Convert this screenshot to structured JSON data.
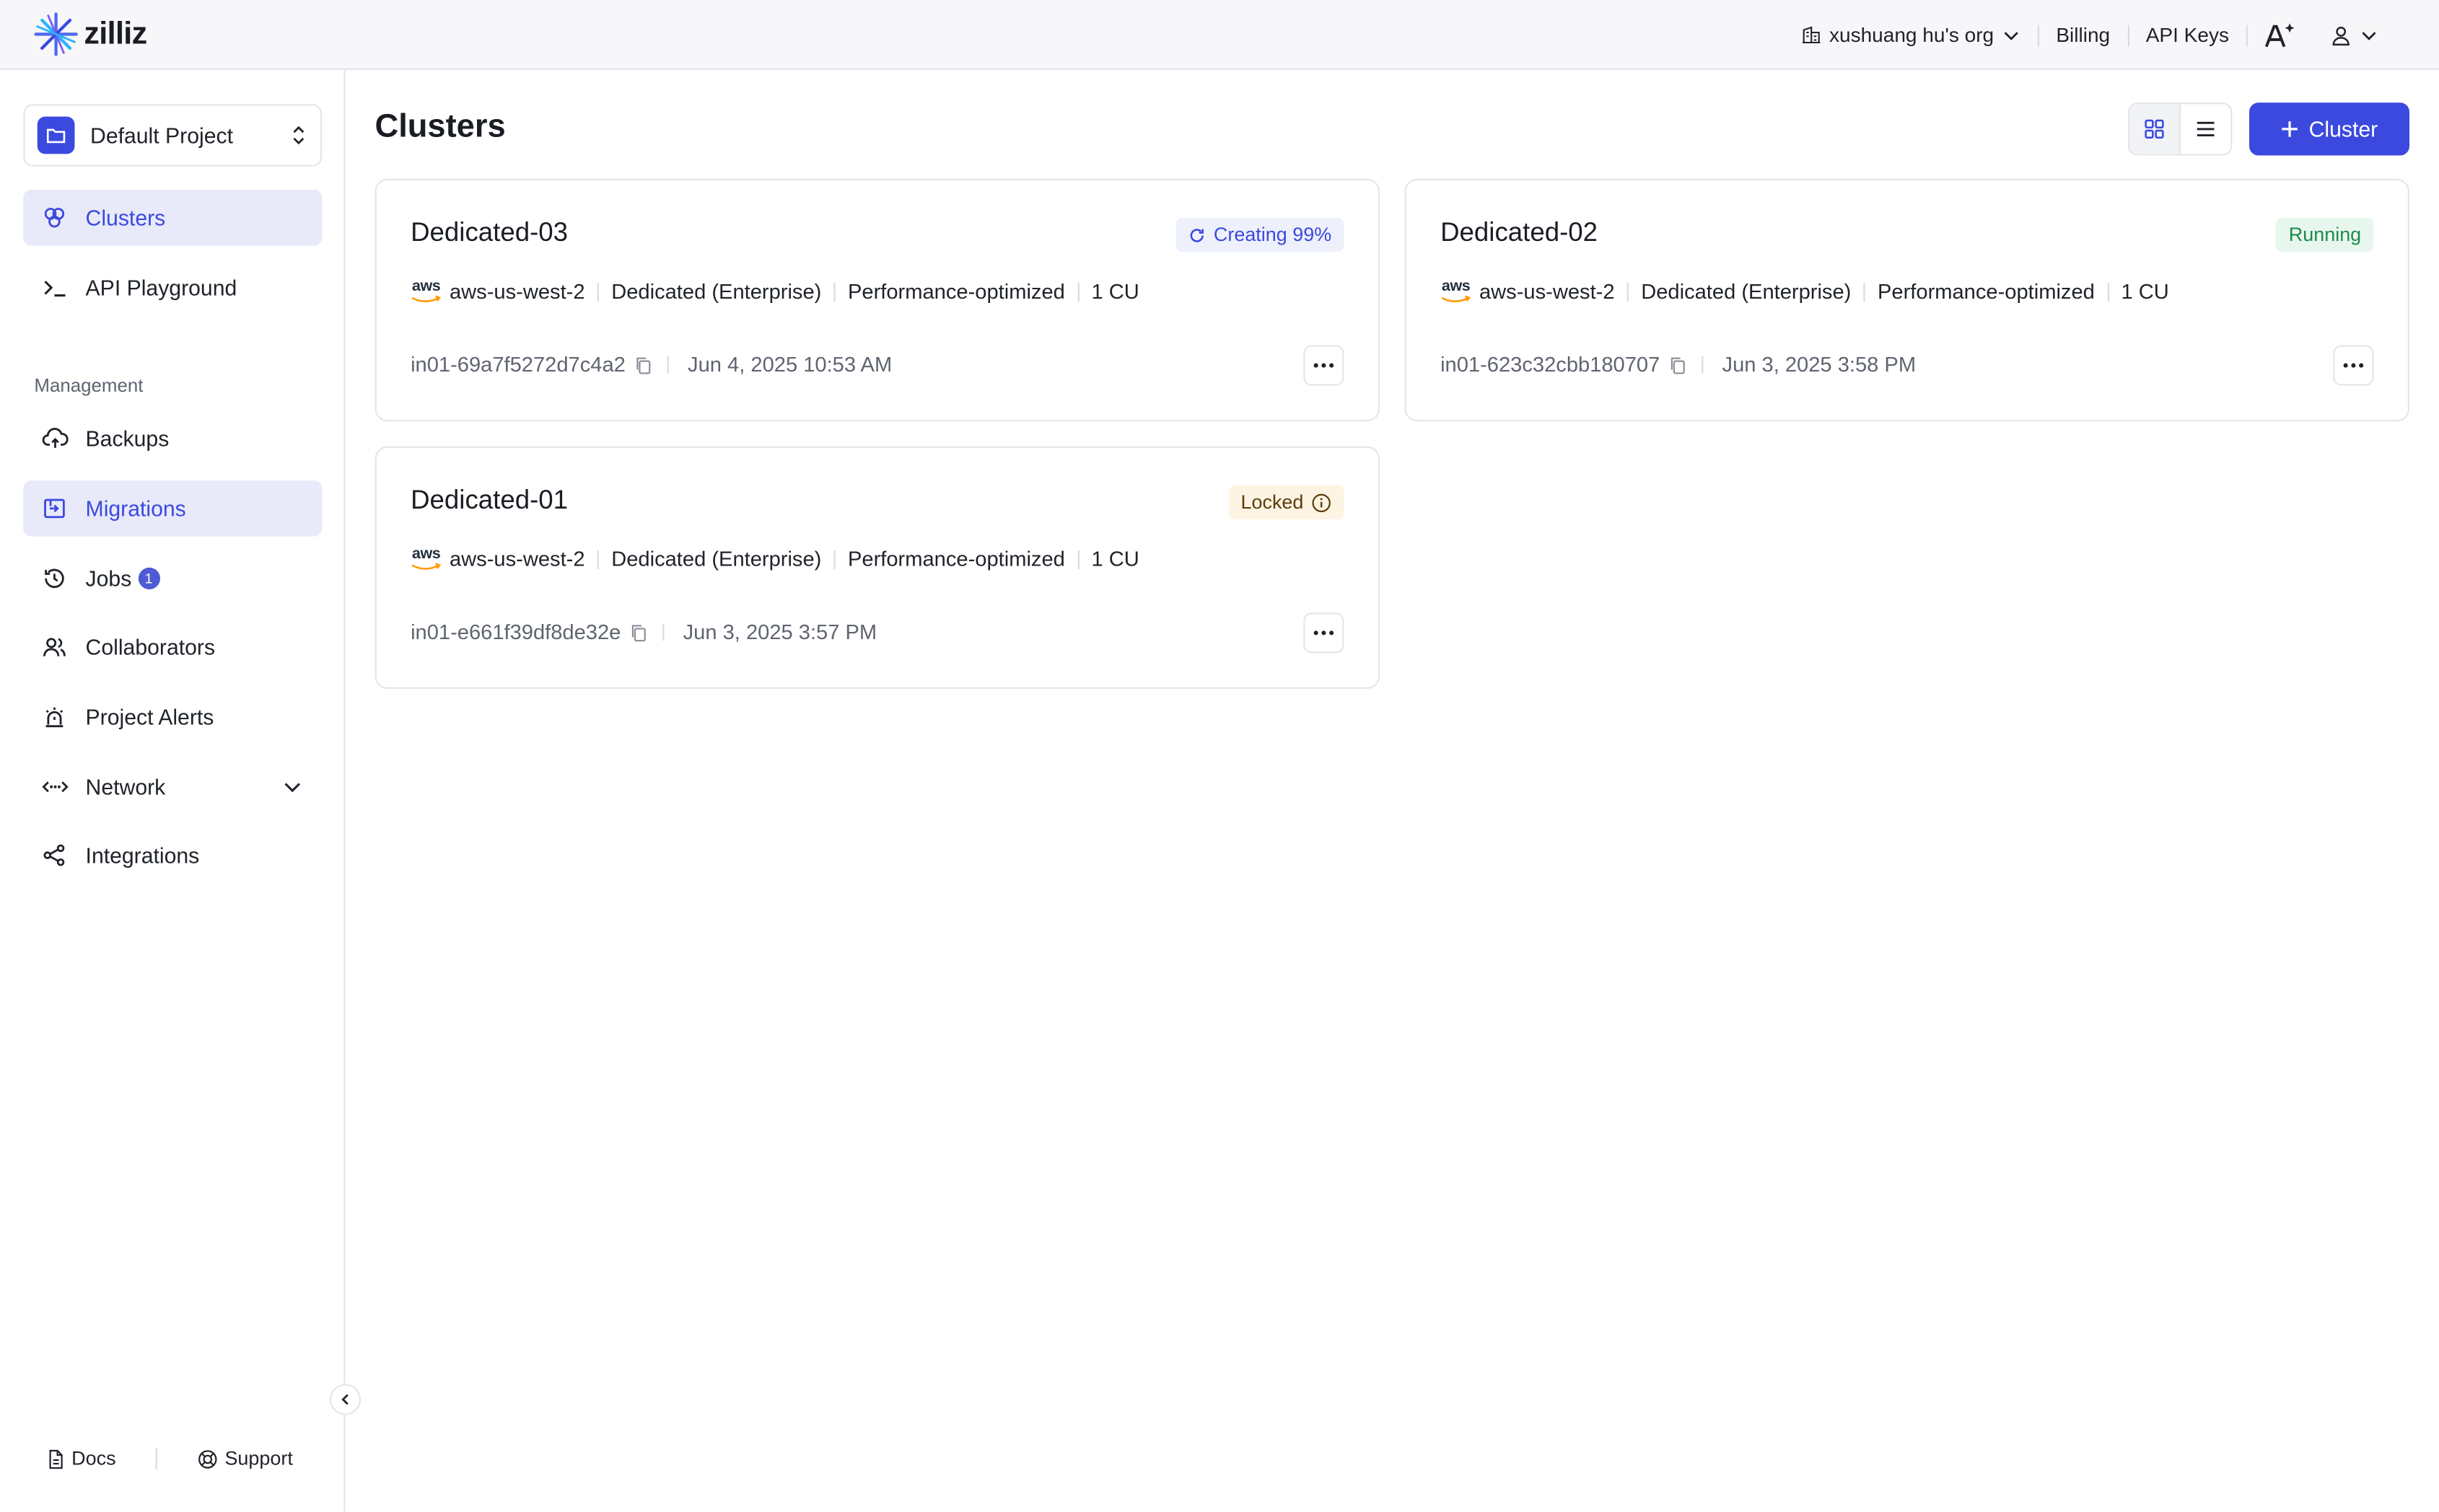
{
  "header": {
    "logo_text": "zilliz",
    "org_name": "xushuang hu's org",
    "billing": "Billing",
    "api_keys": "API Keys"
  },
  "sidebar": {
    "project": "Default Project",
    "items_top": [
      {
        "label": "Clusters",
        "icon": "clusters-icon"
      },
      {
        "label": "API Playground",
        "icon": "terminal-icon"
      }
    ],
    "section_label": "Management",
    "items": [
      {
        "label": "Backups",
        "icon": "cloud-upload-icon"
      },
      {
        "label": "Migrations",
        "icon": "migration-icon"
      },
      {
        "label": "Jobs",
        "icon": "history-icon",
        "badge": "1"
      },
      {
        "label": "Collaborators",
        "icon": "users-icon"
      },
      {
        "label": "Project Alerts",
        "icon": "siren-icon"
      },
      {
        "label": "Network",
        "icon": "network-icon"
      },
      {
        "label": "Integrations",
        "icon": "share-icon"
      }
    ],
    "docs": "Docs",
    "support": "Support"
  },
  "main": {
    "title": "Clusters",
    "add_button": "Cluster"
  },
  "clusters": [
    {
      "name": "Dedicated-03",
      "status": "Creating 99%",
      "region": "aws-us-west-2",
      "plan": "Dedicated (Enterprise)",
      "type": "Performance-optimized",
      "cu": "1 CU",
      "id": "in01-69a7f5272d7c4a2",
      "created": "Jun 4, 2025 10:53 AM"
    },
    {
      "name": "Dedicated-02",
      "status": "Running",
      "region": "aws-us-west-2",
      "plan": "Dedicated (Enterprise)",
      "type": "Performance-optimized",
      "cu": "1 CU",
      "id": "in01-623c32cbb180707",
      "created": "Jun 3, 2025 3:58 PM"
    },
    {
      "name": "Dedicated-01",
      "status": "Locked",
      "region": "aws-us-west-2",
      "plan": "Dedicated (Enterprise)",
      "type": "Performance-optimized",
      "cu": "1 CU",
      "id": "in01-e661f39df8de32e",
      "created": "Jun 3, 2025 3:57 PM"
    }
  ],
  "colors": {
    "accent": "#3b49df",
    "running": "#1e8a4c",
    "locked_bg": "#fdf4e3"
  }
}
